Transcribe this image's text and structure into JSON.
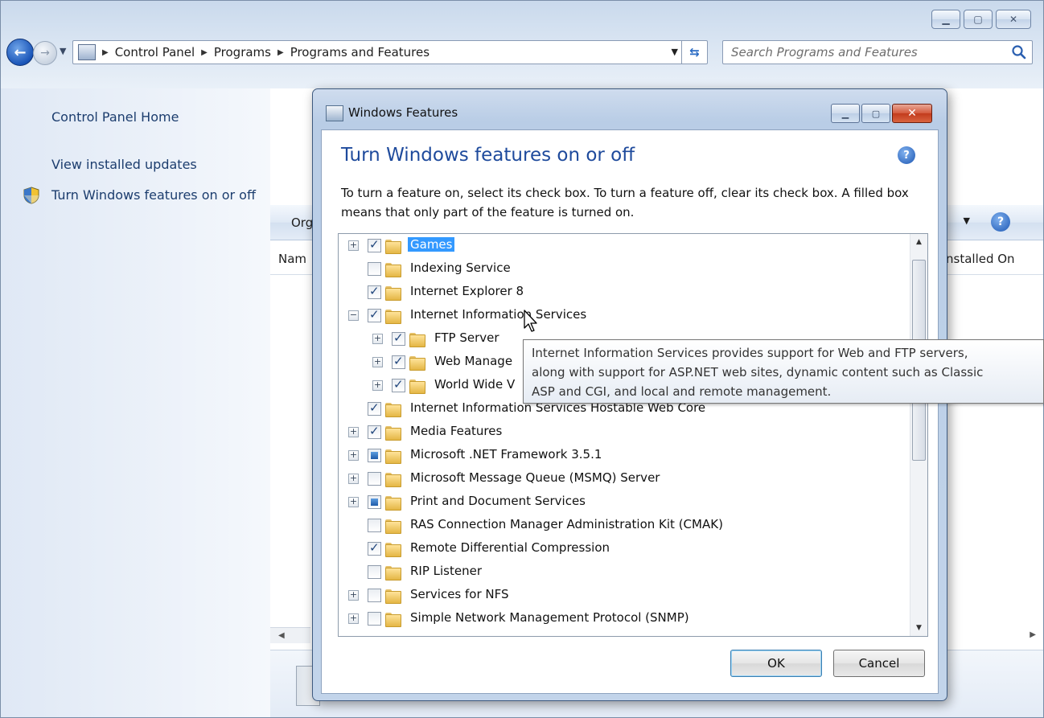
{
  "explorer": {
    "breadcrumbs": [
      "Control Panel",
      "Programs",
      "Programs and Features"
    ],
    "search_placeholder": "Search Programs and Features",
    "left_pane": {
      "links": [
        "Control Panel Home",
        "View installed updates"
      ],
      "features_link": "Turn Windows features on or off"
    },
    "toolbar_label": "Org",
    "columns": {
      "name": "Nam",
      "installed_on": "nstalled On"
    }
  },
  "dialog": {
    "title": "Windows Features",
    "heading": "Turn Windows features on or off",
    "description": "To turn a feature on, select its check box. To turn a feature off, clear its check box. A filled box means that only part of the feature is turned on.",
    "features": [
      {
        "label": "Games",
        "state": "checked",
        "expander": "+",
        "level": 0,
        "selected": true
      },
      {
        "label": "Indexing Service",
        "state": "unchecked",
        "expander": "",
        "level": 0
      },
      {
        "label": "Internet Explorer 8",
        "state": "checked",
        "expander": "",
        "level": 0
      },
      {
        "label": "Internet Information Services",
        "state": "checked",
        "expander": "−",
        "level": 0
      },
      {
        "label": "FTP Server",
        "state": "checked",
        "expander": "+",
        "level": 1
      },
      {
        "label": "Web Manage",
        "state": "checked",
        "expander": "+",
        "level": 1
      },
      {
        "label": "World Wide V",
        "state": "checked",
        "expander": "+",
        "level": 1
      },
      {
        "label": "Internet Information Services Hostable Web Core",
        "state": "checked",
        "expander": "",
        "level": 0
      },
      {
        "label": "Media Features",
        "state": "checked",
        "expander": "+",
        "level": 0
      },
      {
        "label": "Microsoft .NET Framework 3.5.1",
        "state": "partial",
        "expander": "+",
        "level": 0
      },
      {
        "label": "Microsoft Message Queue (MSMQ) Server",
        "state": "unchecked",
        "expander": "+",
        "level": 0
      },
      {
        "label": "Print and Document Services",
        "state": "partial",
        "expander": "+",
        "level": 0
      },
      {
        "label": "RAS Connection Manager Administration Kit (CMAK)",
        "state": "unchecked",
        "expander": "",
        "level": 0
      },
      {
        "label": "Remote Differential Compression",
        "state": "checked",
        "expander": "",
        "level": 0
      },
      {
        "label": "RIP Listener",
        "state": "unchecked",
        "expander": "",
        "level": 0
      },
      {
        "label": "Services for NFS",
        "state": "unchecked",
        "expander": "+",
        "level": 0
      },
      {
        "label": "Simple Network Management Protocol (SNMP)",
        "state": "unchecked",
        "expander": "+",
        "level": 0
      }
    ],
    "ok_label": "OK",
    "cancel_label": "Cancel"
  },
  "tooltip": {
    "lines": [
      "Internet Information Services provides support for Web and FTP servers,",
      "along with support for ASP.NET web sites, dynamic content such as Classic",
      "ASP and CGI, and local and remote management."
    ]
  }
}
